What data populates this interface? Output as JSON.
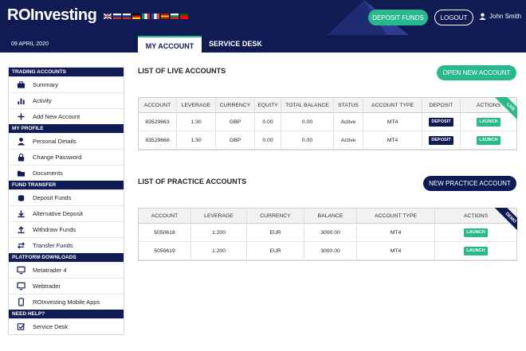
{
  "header": {
    "logo": "ROInvesting",
    "flags": [
      {
        "name": "uk-flag",
        "colors": [
          "#012169",
          "#ffffff",
          "#c8102e"
        ]
      },
      {
        "name": "ru-flag",
        "colors": [
          "#ffffff",
          "#0039a6",
          "#d52b1e"
        ]
      },
      {
        "name": "ru-flag-2",
        "colors": [
          "#ffffff",
          "#0039a6",
          "#d52b1e"
        ]
      },
      {
        "name": "de-flag",
        "colors": [
          "#000000",
          "#dd0000",
          "#ffce00"
        ]
      },
      {
        "name": "it-flag",
        "colors": [
          "#009246",
          "#ffffff",
          "#ce2b37"
        ]
      },
      {
        "name": "fr-flag",
        "colors": [
          "#0055a4",
          "#ffffff",
          "#ef4135"
        ]
      },
      {
        "name": "es-flag",
        "colors": [
          "#aa151b",
          "#f1bf00",
          "#aa151b"
        ]
      },
      {
        "name": "bg-flag",
        "colors": [
          "#ffffff",
          "#00966e",
          "#d62612"
        ]
      },
      {
        "name": "pt-flag",
        "colors": [
          "#006600",
          "#ff0000",
          "#ff0000"
        ]
      }
    ],
    "deposit_label": "DEPOSIT FUNDS",
    "logout_label": "LOGOUT",
    "user_name": "John Smith"
  },
  "subnav": {
    "date": "09 APRIL 2020",
    "tab_account": "MY ACCOUNT",
    "tab_service": "SERVICE DESK"
  },
  "sidebar": {
    "sections": [
      {
        "title": "TRADING ACCOUNTS",
        "items": [
          {
            "label": "Summary",
            "icon": "briefcase-icon"
          },
          {
            "label": "Activity",
            "icon": "bar-chart-icon"
          },
          {
            "label": "Add New Account",
            "icon": "plus-icon"
          }
        ]
      },
      {
        "title": "MY PROFILE",
        "items": [
          {
            "label": "Personal Details",
            "icon": "user-icon"
          },
          {
            "label": "Change Password",
            "icon": "lock-icon"
          },
          {
            "label": "Documents",
            "icon": "folder-icon"
          }
        ]
      },
      {
        "title": "FUND TRANSFER",
        "items": [
          {
            "label": "Deposit Funds",
            "icon": "deposit-icon"
          },
          {
            "label": "Alternative Deposit",
            "icon": "download-icon"
          },
          {
            "label": "Withdraw Funds",
            "icon": "upload-icon"
          },
          {
            "label": "Transfer Funds",
            "icon": "transfer-icon"
          }
        ]
      },
      {
        "title": "PLATFORM DOWNLOADS",
        "items": [
          {
            "label": "Metatrader 4",
            "icon": "monitor-icon"
          },
          {
            "label": "Webtrader",
            "icon": "monitor-icon"
          },
          {
            "label": "ROInvesting Mobile Apps",
            "icon": "mobile-icon"
          }
        ]
      },
      {
        "title": "NEED HELP?",
        "items": [
          {
            "label": "Service Desk",
            "icon": "checkbox-icon"
          }
        ]
      }
    ]
  },
  "live": {
    "title": "LIST OF LIVE ACCOUNTS",
    "button": "OPEN NEW ACCOUNT",
    "badge": "LIVE",
    "columns": [
      "ACCOUNT",
      "LEVERAGE",
      "CURRENCY",
      "EQUITY",
      "TOTAL BALANCE",
      "STATUS",
      "ACCOUNT TYPE",
      "DEPOSIT",
      "ACTIONS"
    ],
    "rows": [
      {
        "account": "83529663",
        "leverage": "1:30",
        "currency": "GBP",
        "equity": "0.00",
        "total_balance": "0.00",
        "status": "Active",
        "account_type": "MT4",
        "deposit": "DEPOSIT",
        "action": "LAUNCH"
      },
      {
        "account": "83529668",
        "leverage": "1:30",
        "currency": "GBP",
        "equity": "0.00",
        "total_balance": "0.00",
        "status": "Active",
        "account_type": "MT4",
        "deposit": "DEPOSIT",
        "action": "LAUNCH"
      }
    ]
  },
  "practice": {
    "title": "LIST OF PRACTICE ACCOUNTS",
    "button": "NEW PRACTICE ACCOUNT",
    "badge": "DEMO",
    "columns": [
      "ACCOUNT",
      "LEVERAGE",
      "CURRENCY",
      "BALANCE",
      "ACCOUNT TYPE",
      "ACTIONS"
    ],
    "rows": [
      {
        "account": "5050618",
        "leverage": "1:200",
        "currency": "EUR",
        "balance": "3000.00",
        "account_type": "MT4",
        "action": "LAUNCH"
      },
      {
        "account": "5050619",
        "leverage": "1:200",
        "currency": "EUR",
        "balance": "3000.00",
        "account_type": "MT4",
        "action": "LAUNCH"
      }
    ]
  },
  "colors": {
    "navy": "#0f1b52",
    "green": "#2ab98c"
  }
}
